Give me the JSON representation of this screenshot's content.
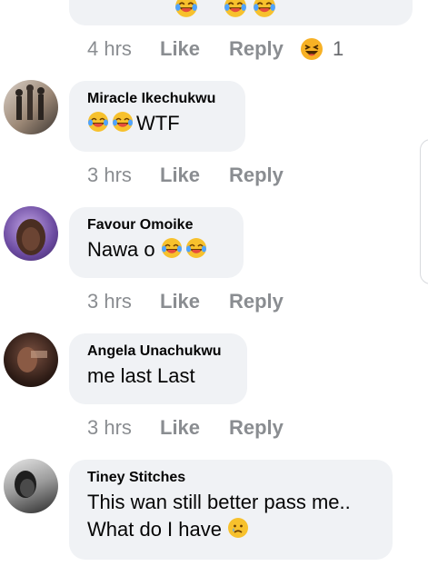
{
  "top_reply": {
    "time": "4 hrs",
    "like": "Like",
    "reply": "Reply",
    "reaction_icon": "haha-reaction-icon",
    "reaction_count": "1"
  },
  "comments": [
    {
      "name": "Miracle Ikechukwu",
      "text": "WTF",
      "emoji": [
        "face-with-tears-of-joy",
        "face-with-tears-of-joy"
      ],
      "time": "3 hrs",
      "like": "Like",
      "reply": "Reply"
    },
    {
      "name": "Favour Omoike",
      "text": "Nawa o",
      "emoji": [
        "face-with-tears-of-joy",
        "face-with-tears-of-joy"
      ],
      "time": "3 hrs",
      "like": "Like",
      "reply": "Reply"
    },
    {
      "name": "Angela Unachukwu",
      "text": "me last Last",
      "time": "3 hrs",
      "like": "Like",
      "reply": "Reply"
    },
    {
      "name": "Tiney Stitches",
      "text_line1": "This wan still better pass me..",
      "text_line2": "What do I have",
      "emoji": [
        "crying-face"
      ]
    }
  ]
}
